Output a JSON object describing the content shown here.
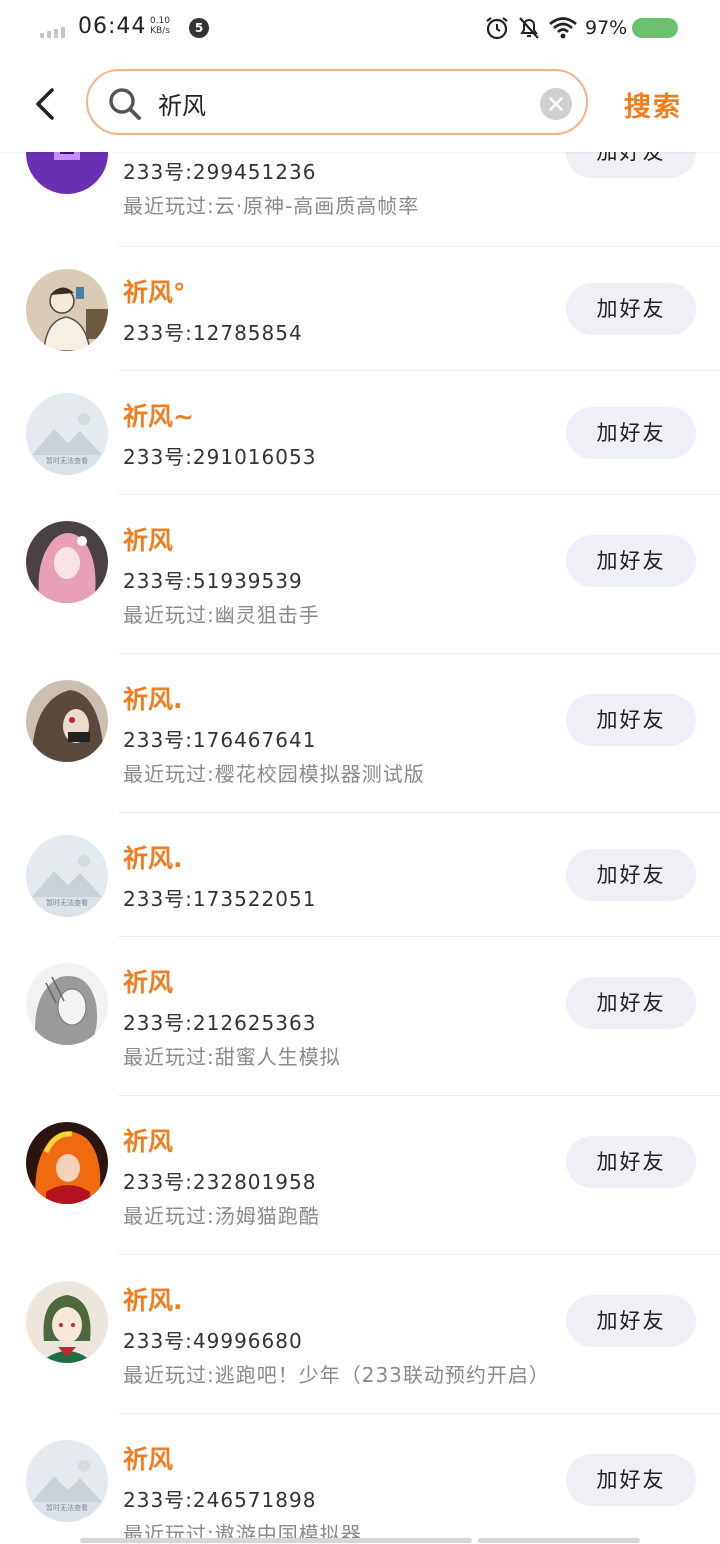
{
  "status_bar": {
    "time": "06:44",
    "net_speed_value": "0.10",
    "net_speed_unit": "KB/s",
    "notification_count": "5",
    "battery_percent": "97%",
    "battery_color": "#6cc070"
  },
  "header": {
    "back_icon": "chevron-left-icon",
    "search_query": "祈风",
    "search_icon": "search-icon",
    "clear_icon": "close-circle-icon",
    "search_button_label": "搜索"
  },
  "colors": {
    "accent": "#f07d1e",
    "search_border": "#f0b48c",
    "button_bg": "#eef0f6"
  },
  "results": [
    {
      "name": "",
      "uid": "233号:299451236",
      "played": "最近玩过:云·原神-高画质高帧率",
      "button": "加好友",
      "avatar": "purple-art-avatar"
    },
    {
      "name": "祈风°",
      "uid": "233号:12785854",
      "played": "",
      "button": "加好友",
      "avatar": "sketch-drinking-avatar"
    },
    {
      "name": "祈风~",
      "uid": "233号:291016053",
      "played": "",
      "button": "加好友",
      "avatar": "default-mountain-avatar",
      "avatar_caption": "暂时无法查看"
    },
    {
      "name": "祈风",
      "uid": "233号:51939539",
      "played": "最近玩过:幽灵狙击手",
      "button": "加好友",
      "avatar": "pink-hair-avatar"
    },
    {
      "name": "祈风.",
      "uid": "233号:176467641",
      "played": "最近玩过:樱花校园模拟器测试版",
      "button": "加好友",
      "avatar": "dark-hair-avatar"
    },
    {
      "name": "祈风.",
      "uid": "233号:173522051",
      "played": "",
      "button": "加好友",
      "avatar": "default-mountain-avatar",
      "avatar_caption": "暂时无法查看"
    },
    {
      "name": "祈风",
      "uid": "233号:212625363",
      "played": "最近玩过:甜蜜人生模拟",
      "button": "加好友",
      "avatar": "sketch-girl-avatar"
    },
    {
      "name": "祈风",
      "uid": "233号:232801958",
      "played": "最近玩过:汤姆猫跑酷",
      "button": "加好友",
      "avatar": "fire-character-avatar"
    },
    {
      "name": "祈风.",
      "uid": "233号:49996680",
      "played": "最近玩过:逃跑吧！少年（233联动预约开启）",
      "button": "加好友",
      "avatar": "green-hair-character-avatar"
    },
    {
      "name": "祈风",
      "uid": "233号:246571898",
      "played": "最近玩过:遨游中国模拟器",
      "button": "加好友",
      "avatar": "default-mountain-avatar",
      "avatar_caption": "暂时无法查看"
    }
  ]
}
